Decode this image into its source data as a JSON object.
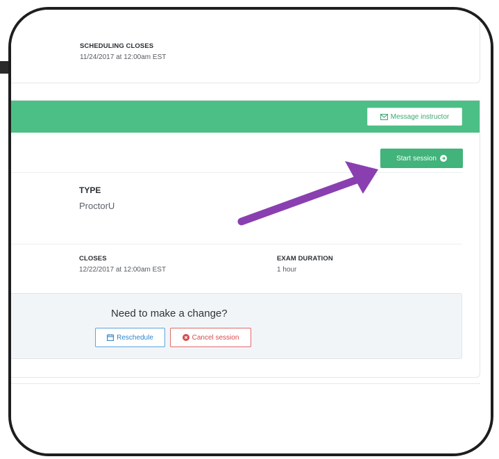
{
  "scheduling": {
    "label": "SCHEDULING CLOSES",
    "value": "11/24/2017 at 12:00am EST"
  },
  "session": {
    "header_color": "#4cbf86",
    "message_instructor_label": "Message instructor",
    "start_session_label": "Start session",
    "type_label": "TYPE",
    "type_value": "ProctorU",
    "closes_label": "CLOSES",
    "closes_value": "12/22/2017 at 12:00am EST",
    "duration_label": "EXAM DURATION",
    "duration_value": "1 hour"
  },
  "change": {
    "title": "Need to make a change?",
    "reschedule_label": "Reschedule",
    "cancel_label": "Cancel session"
  },
  "icons": {
    "message": "envelope-icon",
    "start": "arrow-circle-right-icon",
    "reschedule": "calendar-icon",
    "cancel": "close-circle-icon"
  },
  "annotation": {
    "arrow_color": "#8a3fb0"
  }
}
